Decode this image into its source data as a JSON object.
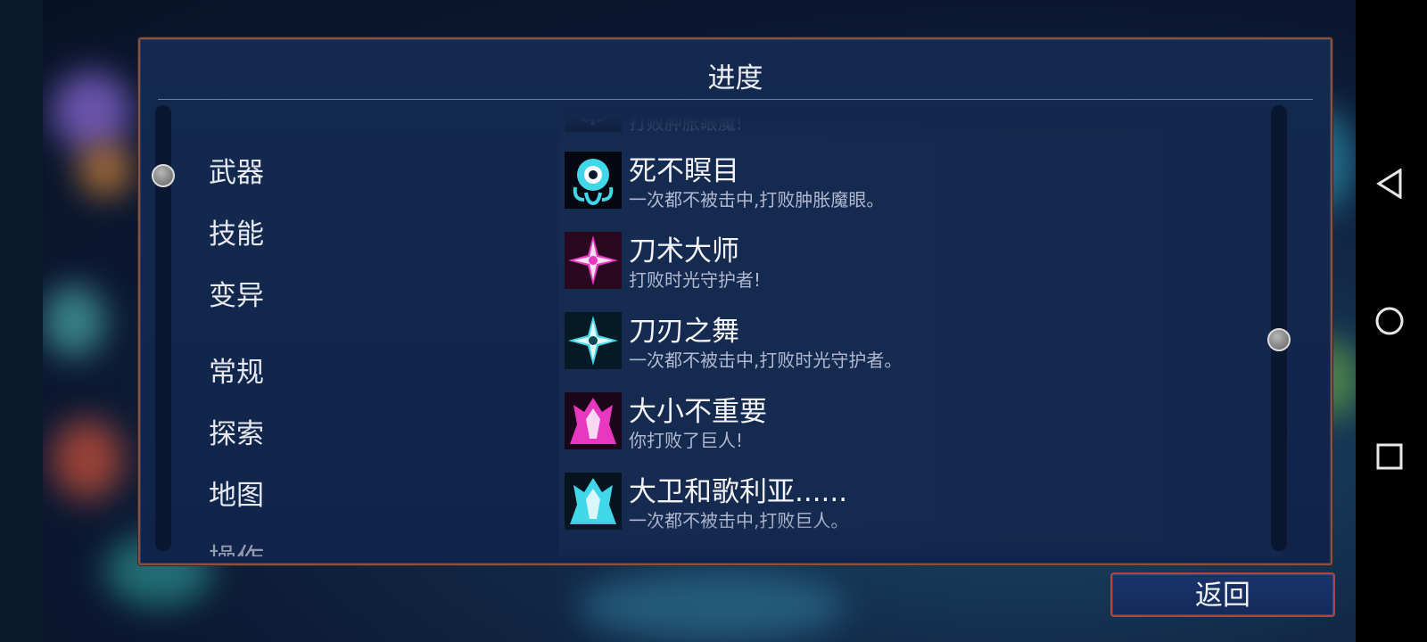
{
  "title": "进度",
  "categories": [
    "武器",
    "技能",
    "变异",
    "常规",
    "探索",
    "地图",
    "操作"
  ],
  "achievements": [
    {
      "name": "",
      "desc": "打败肿胀眼魔!",
      "icon": "eye-monster-icon",
      "color": "#b070d8"
    },
    {
      "name": "死不瞑目",
      "desc": "一次都不被击中,打败肿胀魔眼。",
      "icon": "eye-monster-icon",
      "color": "#40d8e8"
    },
    {
      "name": "刀术大师",
      "desc": "打败时光守护者!",
      "icon": "shuriken-icon",
      "color": "#e838c0"
    },
    {
      "name": "刀刃之舞",
      "desc": "一次都不被击中,打败时光守护者。",
      "icon": "shuriken-icon",
      "color": "#40d8e8"
    },
    {
      "name": "大小不重要",
      "desc": "你打败了巨人!",
      "icon": "giant-icon",
      "color": "#e838c0"
    },
    {
      "name": "大卫和歌利亚......",
      "desc": "一次都不被击中,打败巨人。",
      "icon": "giant-icon",
      "color": "#40d8e8"
    }
  ],
  "back_label": "返回",
  "colors": {
    "panel_border": "#8a5040",
    "accent_cyan": "#40d8e8",
    "accent_magenta": "#e838c0"
  }
}
